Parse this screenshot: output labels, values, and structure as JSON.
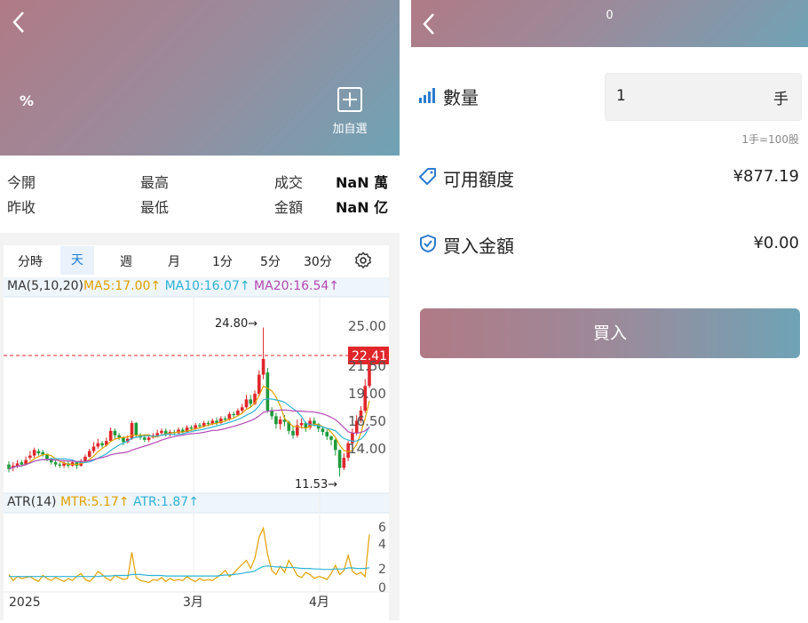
{
  "left": {
    "change_pct": "%",
    "add_watchlist": "加自選",
    "stats": {
      "open_label": "今開",
      "high_label": "最高",
      "volume_label": "成交",
      "volume_value": "NaN 萬",
      "prev_close_label": "昨收",
      "low_label": "最低",
      "amount_label": "金額",
      "amount_value": "NaN 亿"
    },
    "tabs": [
      "分時",
      "天",
      "週",
      "月",
      "1分",
      "5分",
      "30分"
    ],
    "active_tab": "天",
    "ma_legend": {
      "name": "MA(5,10,20)",
      "ma5": "MA5:17.00↑",
      "ma10": "MA10:16.07↑",
      "ma20": "MA20:16.54↑"
    },
    "atr_legend": {
      "name": "ATR(14)",
      "mtr": "MTR:5.17↑",
      "atr": "ATR:1.87↑"
    }
  },
  "chart_data": {
    "type": "candlestick",
    "price_axis_ticks": [
      "25.00",
      "21.50",
      "19.00",
      "16.50",
      "14.00"
    ],
    "current_price": "22.41",
    "high_annotation": "24.80→",
    "low_annotation": "11.53→",
    "atr_axis_ticks": [
      "6",
      "4",
      "2",
      "0"
    ],
    "x_labels": [
      "2025",
      "3月",
      "4月"
    ],
    "candles": [
      [
        12.6,
        12.2,
        12.9,
        11.9
      ],
      [
        12.3,
        12.5,
        12.8,
        12.0
      ],
      [
        12.4,
        12.7,
        13.0,
        12.3
      ],
      [
        12.8,
        12.6,
        13.0,
        12.4
      ],
      [
        12.6,
        13.0,
        13.3,
        12.5
      ],
      [
        13.2,
        13.4,
        13.8,
        13.0
      ],
      [
        13.4,
        13.9,
        14.1,
        13.2
      ],
      [
        13.8,
        13.6,
        14.0,
        13.4
      ],
      [
        13.7,
        13.5,
        13.9,
        13.3
      ],
      [
        13.5,
        13.1,
        13.6,
        12.9
      ],
      [
        13.1,
        12.8,
        13.2,
        12.6
      ],
      [
        12.8,
        12.6,
        13.0,
        12.4
      ],
      [
        12.6,
        12.5,
        12.8,
        12.3
      ],
      [
        12.5,
        12.7,
        12.9,
        12.3
      ],
      [
        12.7,
        12.5,
        12.9,
        12.3
      ],
      [
        12.5,
        12.8,
        13.0,
        12.4
      ],
      [
        12.8,
        12.5,
        12.9,
        12.2
      ],
      [
        12.5,
        12.9,
        13.1,
        12.4
      ],
      [
        12.9,
        13.3,
        13.5,
        12.8
      ],
      [
        13.3,
        13.8,
        14.0,
        13.2
      ],
      [
        13.8,
        14.2,
        14.6,
        13.6
      ],
      [
        14.2,
        14.5,
        14.9,
        14.0
      ],
      [
        14.5,
        14.3,
        14.7,
        14.1
      ],
      [
        14.3,
        14.7,
        15.0,
        14.2
      ],
      [
        14.7,
        15.6,
        15.9,
        14.6
      ],
      [
        15.6,
        15.2,
        15.8,
        14.9
      ],
      [
        15.2,
        15.0,
        15.4,
        14.8
      ],
      [
        15.0,
        14.6,
        15.1,
        14.3
      ],
      [
        14.6,
        14.9,
        15.2,
        14.5
      ],
      [
        14.9,
        16.3,
        16.5,
        14.8
      ],
      [
        16.3,
        15.2,
        16.4,
        15.0
      ],
      [
        15.2,
        15.0,
        15.4,
        14.8
      ],
      [
        15.0,
        14.8,
        15.3,
        14.6
      ],
      [
        14.8,
        15.0,
        15.2,
        14.6
      ],
      [
        15.0,
        15.2,
        15.4,
        14.9
      ],
      [
        15.2,
        15.4,
        15.7,
        15.0
      ],
      [
        15.4,
        15.6,
        15.8,
        15.2
      ],
      [
        15.6,
        15.3,
        15.8,
        15.1
      ],
      [
        15.3,
        15.5,
        15.7,
        15.1
      ],
      [
        15.5,
        15.4,
        15.7,
        15.2
      ],
      [
        15.4,
        15.7,
        15.9,
        15.3
      ],
      [
        15.7,
        15.5,
        15.9,
        15.3
      ],
      [
        15.5,
        15.9,
        16.1,
        15.4
      ],
      [
        15.9,
        15.8,
        16.1,
        15.6
      ],
      [
        15.8,
        16.1,
        16.3,
        15.7
      ],
      [
        16.1,
        16.0,
        16.3,
        15.8
      ],
      [
        16.0,
        16.3,
        16.5,
        15.9
      ],
      [
        16.3,
        16.2,
        16.5,
        16.0
      ],
      [
        16.2,
        16.5,
        16.7,
        16.1
      ],
      [
        16.5,
        16.3,
        16.8,
        16.1
      ],
      [
        16.3,
        16.7,
        16.9,
        16.2
      ],
      [
        16.7,
        16.6,
        16.9,
        16.4
      ],
      [
        16.6,
        17.1,
        17.3,
        16.5
      ],
      [
        17.1,
        17.0,
        17.3,
        16.8
      ],
      [
        17.0,
        17.4,
        17.6,
        16.9
      ],
      [
        17.4,
        17.7,
        18.0,
        17.2
      ],
      [
        17.7,
        18.4,
        18.8,
        17.6
      ],
      [
        18.4,
        18.0,
        18.8,
        17.7
      ],
      [
        18.0,
        18.9,
        19.2,
        17.9
      ],
      [
        18.9,
        20.6,
        21.0,
        18.7
      ],
      [
        20.6,
        22.0,
        24.8,
        20.2
      ],
      [
        20.8,
        17.4,
        21.2,
        17.2
      ],
      [
        17.4,
        16.9,
        17.7,
        16.6
      ],
      [
        16.9,
        16.2,
        17.2,
        15.8
      ],
      [
        16.2,
        16.6,
        16.9,
        15.7
      ],
      [
        16.6,
        16.4,
        17.0,
        16.0
      ],
      [
        16.4,
        15.6,
        16.5,
        15.3
      ],
      [
        15.6,
        15.2,
        16.0,
        14.9
      ],
      [
        15.2,
        16.1,
        16.6,
        15.0
      ],
      [
        16.1,
        16.3,
        16.7,
        15.8
      ],
      [
        16.3,
        15.9,
        16.4,
        15.5
      ],
      [
        15.9,
        16.5,
        16.8,
        15.7
      ],
      [
        16.5,
        16.2,
        16.8,
        16.0
      ],
      [
        16.2,
        15.8,
        16.3,
        15.5
      ],
      [
        15.8,
        15.5,
        16.0,
        15.2
      ],
      [
        15.5,
        15.1,
        15.7,
        14.8
      ],
      [
        15.1,
        14.8,
        15.2,
        14.3
      ],
      [
        14.8,
        13.9,
        14.9,
        13.4
      ],
      [
        13.9,
        12.3,
        13.9,
        11.53
      ],
      [
        12.3,
        13.2,
        13.6,
        12.1
      ],
      [
        13.2,
        14.5,
        14.7,
        12.9
      ],
      [
        14.5,
        15.4,
        15.8,
        14.3
      ],
      [
        15.4,
        16.5,
        17.0,
        15.2
      ],
      [
        16.5,
        17.4,
        17.8,
        16.3
      ],
      [
        17.4,
        19.6,
        20.2,
        17.2
      ],
      [
        19.6,
        22.41,
        22.8,
        19.4
      ]
    ],
    "atr": {
      "mtr": [
        1.2,
        0.6,
        1.0,
        0.8,
        0.9,
        1.0,
        0.7,
        0.5,
        1.1,
        0.8,
        0.6,
        0.9,
        0.7,
        0.5,
        0.8,
        0.6,
        1.0,
        1.3,
        0.7,
        0.5,
        0.9,
        1.5,
        1.2,
        0.8,
        0.6,
        1.1,
        0.9,
        0.7,
        0.8,
        3.4,
        0.9,
        0.6,
        0.5,
        0.4,
        0.7,
        0.6,
        0.9,
        0.5,
        0.8,
        0.6,
        0.7,
        0.6,
        1.0,
        0.7,
        0.5,
        0.8,
        0.6,
        0.7,
        0.6,
        0.9,
        1.2,
        1.6,
        1.0,
        1.3,
        1.8,
        2.2,
        2.6,
        1.8,
        2.8,
        4.9,
        5.8,
        3.2,
        1.6,
        1.2,
        2.0,
        1.4,
        2.6,
        1.9,
        1.1,
        0.9,
        1.4,
        1.2,
        0.8,
        1.0,
        0.9,
        0.7,
        1.3,
        2.1,
        1.2,
        1.6,
        3.1,
        1.5,
        1.2,
        1.4,
        1.0,
        5.17
      ],
      "atr": [
        1.0,
        1.0,
        1.0,
        1.0,
        1.0,
        1.0,
        1.0,
        1.0,
        1.0,
        1.0,
        1.0,
        1.0,
        1.0,
        1.0,
        1.0,
        1.0,
        1.0,
        1.0,
        1.0,
        1.0,
        1.0,
        1.0,
        1.05,
        1.05,
        1.05,
        1.1,
        1.1,
        1.1,
        1.1,
        1.2,
        1.2,
        1.2,
        1.15,
        1.1,
        1.1,
        1.1,
        1.1,
        1.05,
        1.05,
        1.05,
        1.05,
        1.05,
        1.05,
        1.05,
        1.05,
        1.05,
        1.05,
        1.05,
        1.05,
        1.05,
        1.1,
        1.15,
        1.15,
        1.2,
        1.25,
        1.3,
        1.4,
        1.45,
        1.55,
        1.8,
        2.0,
        2.05,
        2.0,
        1.95,
        1.95,
        1.9,
        1.9,
        1.9,
        1.85,
        1.8,
        1.8,
        1.8,
        1.75,
        1.75,
        1.7,
        1.7,
        1.7,
        1.75,
        1.75,
        1.75,
        1.85,
        1.85,
        1.8,
        1.8,
        1.8,
        1.87
      ]
    }
  },
  "right": {
    "title": "0",
    "quantity_label": "數量",
    "quantity_value": "1",
    "quantity_unit": "手",
    "lot_note": "1手=100股",
    "available_label": "可用額度",
    "available_value": "¥877.19",
    "buy_amount_label": "買入金額",
    "buy_amount_value": "¥0.00",
    "buy_button": "買入"
  },
  "colors": {
    "up": "#e0262b",
    "down": "#1f9a3a",
    "accent": "#1c7ad6"
  }
}
